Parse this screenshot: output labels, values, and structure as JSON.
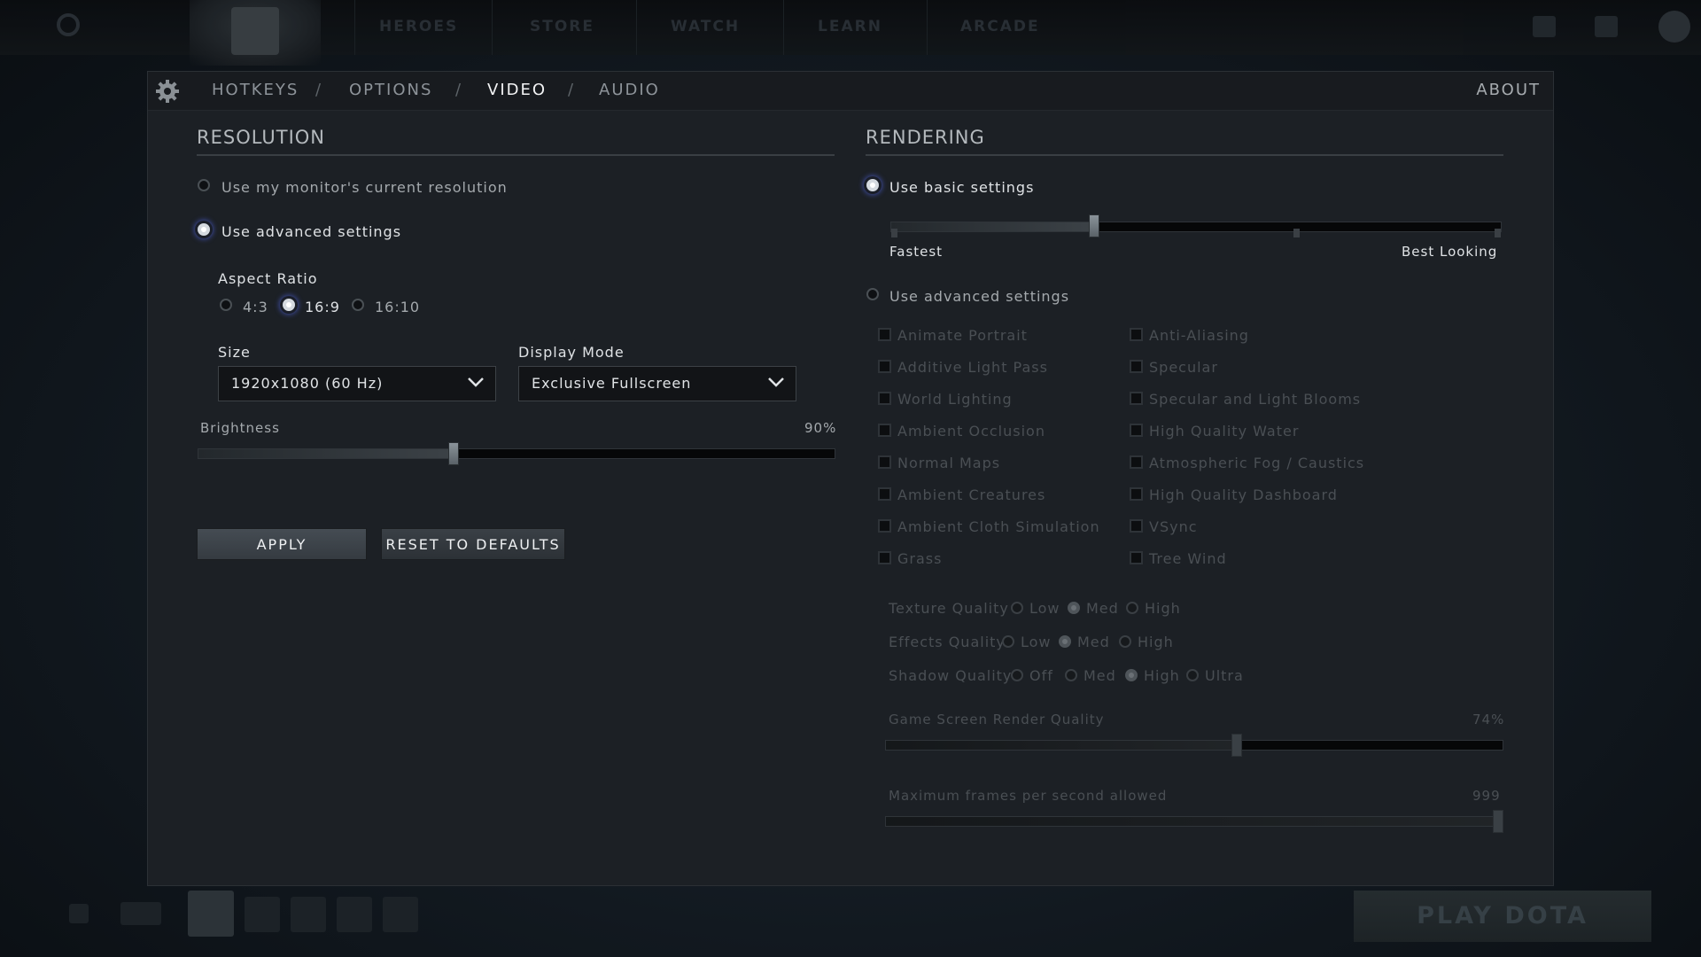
{
  "topnav": {
    "items": [
      "HEROES",
      "STORE",
      "WATCH",
      "LEARN",
      "ARCADE"
    ]
  },
  "tabs": [
    {
      "label": "HOTKEYS"
    },
    {
      "label": "OPTIONS"
    },
    {
      "label": "VIDEO"
    },
    {
      "label": "AUDIO"
    }
  ],
  "tab_separator": "/",
  "about_label": "ABOUT",
  "resolution": {
    "title": "RESOLUTION",
    "use_monitor_label": "Use my monitor's current resolution",
    "use_advanced_label": "Use advanced settings",
    "aspect_ratio_label": "Aspect Ratio",
    "aspect_options": [
      "4:3",
      "16:9",
      "16:10"
    ],
    "aspect_selected": "16:9",
    "size_label": "Size",
    "size_value": "1920x1080 (60 Hz)",
    "display_mode_label": "Display Mode",
    "display_mode_value": "Exclusive Fullscreen",
    "brightness_label": "Brightness",
    "brightness_value": "90%",
    "brightness_level": 0.4,
    "apply_label": "APPLY",
    "reset_label": "RESET TO DEFAULTS"
  },
  "rendering": {
    "title": "RENDERING",
    "use_basic_label": "Use basic settings",
    "basic_level": 0.33,
    "fastest_label": "Fastest",
    "best_label": "Best Looking",
    "use_advanced_label": "Use advanced settings",
    "checks_left": [
      "Animate Portrait",
      "Additive Light Pass",
      "World Lighting",
      "Ambient Occlusion",
      "Normal Maps",
      "Ambient Creatures",
      "Ambient Cloth Simulation",
      "Grass"
    ],
    "checks_right": [
      "Anti-Aliasing",
      "Specular",
      "Specular and Light Blooms",
      "High Quality Water",
      "Atmospheric Fog / Caustics",
      "High Quality Dashboard",
      "VSync",
      "Tree Wind"
    ],
    "texture_quality": {
      "label": "Texture Quality",
      "options": [
        "Low",
        "Med",
        "High"
      ],
      "selected": "Med"
    },
    "effects_quality": {
      "label": "Effects Quality",
      "options": [
        "Low",
        "Med",
        "High"
      ],
      "selected": "Med"
    },
    "shadow_quality": {
      "label": "Shadow Quality",
      "options": [
        "Off",
        "Med",
        "High",
        "Ultra"
      ],
      "selected": "High"
    },
    "render_quality_label": "Game Screen Render Quality",
    "render_quality_value": "74%",
    "render_quality_level": 0.57,
    "max_fps_label": "Maximum frames per second allowed",
    "max_fps_value": "999",
    "max_fps_level": 1.0
  },
  "play_label": "PLAY DOTA",
  "colors": {
    "accent_glow": "#3d4b9c",
    "panel_bg": "#1c2025"
  }
}
